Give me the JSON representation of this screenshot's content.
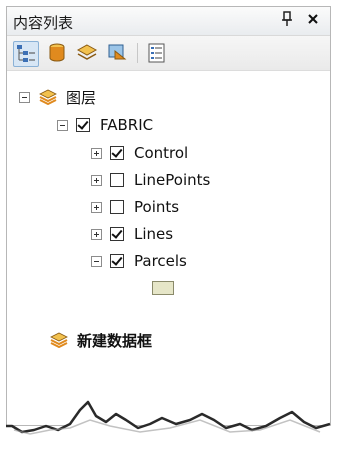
{
  "window": {
    "title": "内容列表",
    "pin_glyph": "ᵖ",
    "close_glyph": "✕"
  },
  "toolbar": {
    "tools": [
      {
        "name": "list-by-drawing-order-icon",
        "active": true
      },
      {
        "name": "list-by-source-icon",
        "active": false
      },
      {
        "name": "list-by-visibility-icon",
        "active": false
      },
      {
        "name": "list-by-selection-icon",
        "active": false
      },
      {
        "name": "options-icon",
        "active": false
      }
    ]
  },
  "tree": {
    "root": {
      "label": "图层",
      "expanded": true
    },
    "group": {
      "label": "FABRIC",
      "checked": true,
      "expanded": true
    },
    "layers": [
      {
        "label": "Control",
        "checked": true,
        "expanded": false
      },
      {
        "label": "LinePoints",
        "checked": false,
        "expanded": false
      },
      {
        "label": "Points",
        "checked": false,
        "expanded": false
      },
      {
        "label": "Lines",
        "checked": true,
        "expanded": false
      },
      {
        "label": "Parcels",
        "checked": true,
        "expanded": true
      }
    ],
    "new_frame": {
      "label": "新建数据框"
    }
  },
  "colors": {
    "swatch_fill": "#e6e6c8",
    "layer_icon_yellow": "#f2c14e",
    "layer_icon_orange": "#e08a1e"
  }
}
